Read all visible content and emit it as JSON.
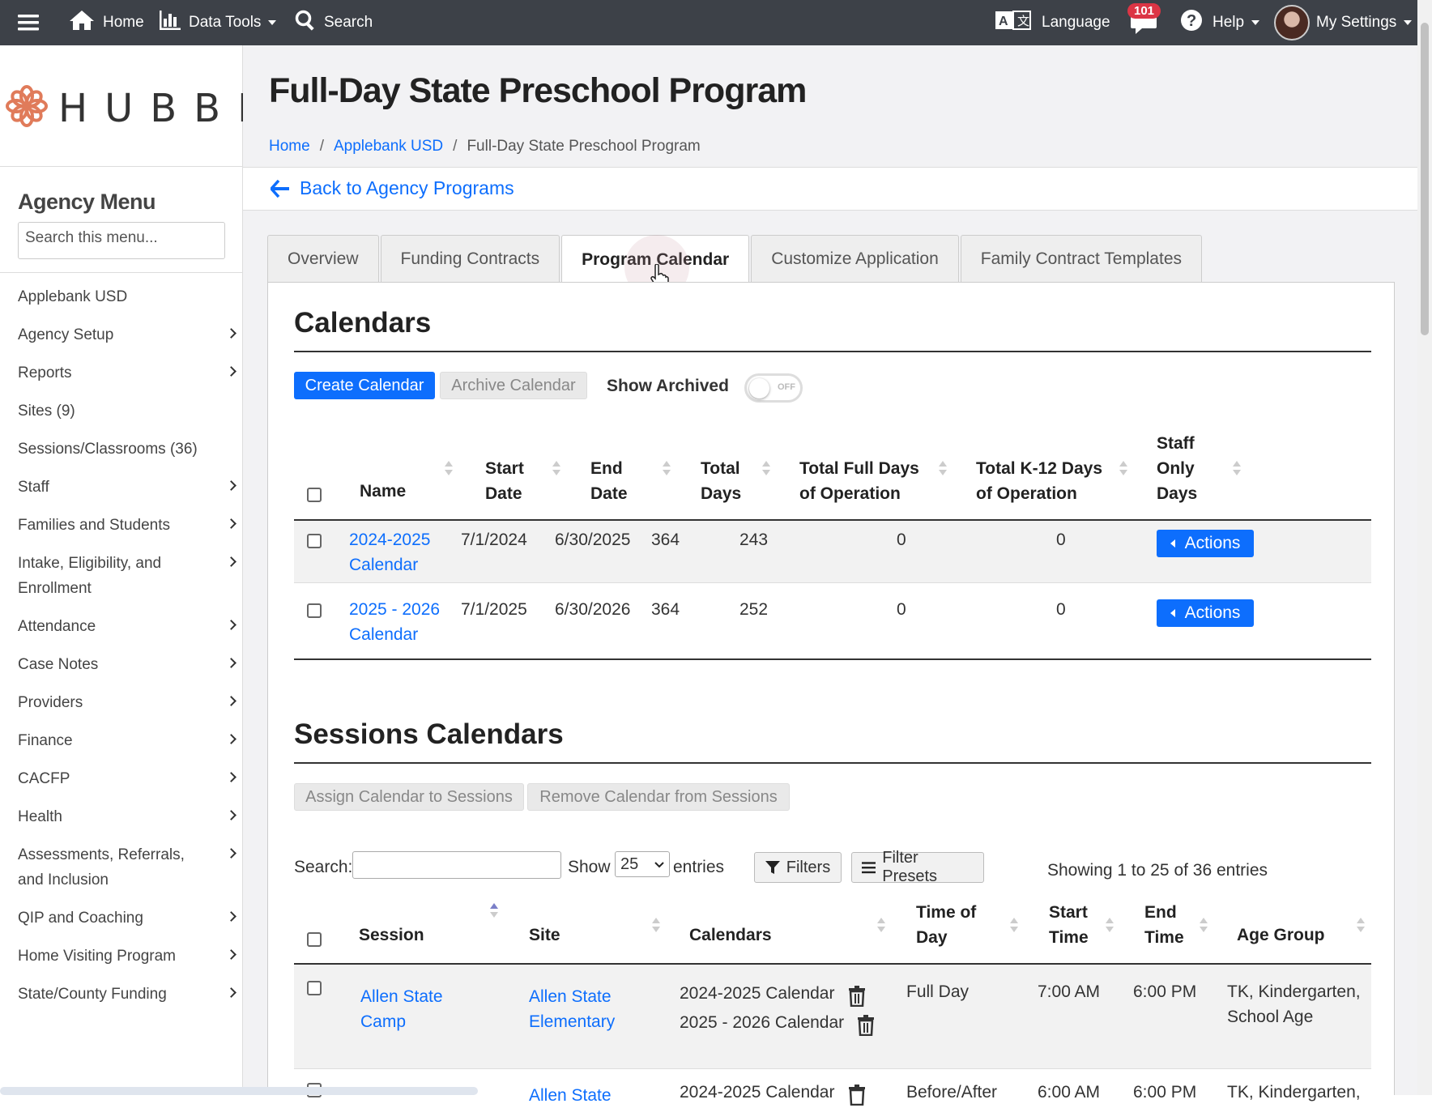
{
  "topbar": {
    "home": "Home",
    "data_tools": "Data Tools",
    "search": "Search",
    "language": "Language",
    "notifications": "101",
    "help": "Help",
    "settings": "My Settings"
  },
  "sidebar": {
    "logo": "HUBBE",
    "title": "Agency Menu",
    "search_placeholder": "Search this menu...",
    "items": [
      {
        "label": "Applebank USD"
      },
      {
        "label": "Agency Setup"
      },
      {
        "label": "Reports"
      },
      {
        "label": "Sites (9)"
      },
      {
        "label": "Sessions/Classrooms (36)"
      },
      {
        "label": "Staff"
      },
      {
        "label": "Families and Students"
      },
      {
        "label": "Intake, Eligibility, and Enrollment"
      },
      {
        "label": "Attendance"
      },
      {
        "label": "Case Notes"
      },
      {
        "label": "Providers"
      },
      {
        "label": "Finance"
      },
      {
        "label": "CACFP"
      },
      {
        "label": "Health"
      },
      {
        "label": "Assessments, Referrals, and Inclusion"
      },
      {
        "label": "QIP and Coaching"
      },
      {
        "label": "Home Visiting Program"
      },
      {
        "label": "State/County Funding"
      }
    ]
  },
  "header": {
    "title": "Full-Day State Preschool Program",
    "breadcrumb": [
      "Home",
      "Applebank USD",
      "Full-Day State Preschool Program"
    ],
    "back_link": "Back to Agency Programs"
  },
  "tabs": [
    "Overview",
    "Funding Contracts",
    "Program Calendar",
    "Customize Application",
    "Family Contract Templates"
  ],
  "calendars": {
    "title": "Calendars",
    "create_btn": "Create Calendar",
    "archive_btn": "Archive Calendar",
    "show_archived": "Show Archived",
    "toggle_text": "OFF",
    "columns": [
      "Name",
      "Start Date",
      "End Date",
      "Total Days",
      "Total Full Days of Operation",
      "Total K-12 Days of Operation",
      "Staff Only Days"
    ],
    "rows": [
      {
        "name": "2024-2025 Calendar",
        "start": "7/1/2024",
        "end": "6/30/2025",
        "total": "364",
        "full": "243",
        "k12": "0",
        "staff": "0",
        "action": "Actions"
      },
      {
        "name": "2025 - 2026 Calendar",
        "start": "7/1/2025",
        "end": "6/30/2026",
        "total": "364",
        "full": "252",
        "k12": "0",
        "staff": "0",
        "action": "Actions"
      }
    ]
  },
  "sessions": {
    "title": "Sessions Calendars",
    "assign_btn": "Assign Calendar to Sessions",
    "remove_btn": "Remove Calendar from Sessions",
    "search_label": "Search:",
    "show_label": "Show",
    "entries_value": "25",
    "entries_label": "entries",
    "filters_btn": "Filters",
    "presets_btn": "Filter Presets",
    "showing": "Showing 1 to 25 of 36 entries",
    "columns": [
      "Session",
      "Site",
      "Calendars",
      "Time of Day",
      "Start Time",
      "End Time",
      "Age Group"
    ],
    "rows": [
      {
        "session": "Allen State Camp",
        "site": "Allen State Elementary",
        "calendars": [
          "2024-2025 Calendar",
          "2025 - 2026 Calendar"
        ],
        "tod": "Full Day",
        "start": "7:00 AM",
        "end": "6:00 PM",
        "age": "TK, Kindergarten, School Age"
      },
      {
        "session": "",
        "site": "Allen State",
        "calendars": [
          "2024-2025 Calendar"
        ],
        "tod": "Before/After",
        "start": "6:00 AM",
        "end": "6:00 PM",
        "age": "TK, Kindergarten,"
      }
    ]
  }
}
